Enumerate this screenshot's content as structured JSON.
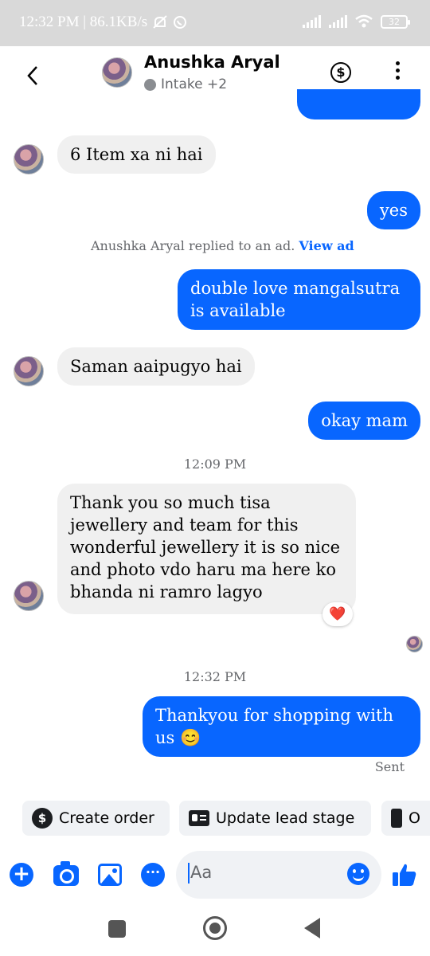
{
  "status_bar": {
    "time_speed": "12:32 PM | 86.1KB/s",
    "battery": "32"
  },
  "header": {
    "name": "Anushka Aryal",
    "subtitle": "Intake +2",
    "icons": [
      "back-arrow-icon",
      "dollar-icon",
      "more-vertical-icon"
    ]
  },
  "messages": [
    {
      "from": "contact",
      "text": "6 Item xa ni hai"
    },
    {
      "from": "me",
      "text": "yes"
    },
    {
      "type": "notice",
      "text": "Anushka Aryal replied to an ad.",
      "link": "View ad"
    },
    {
      "from": "me",
      "text": "double love mangalsutra is available"
    },
    {
      "from": "contact",
      "text": "Saman aaipugyo hai"
    },
    {
      "from": "me",
      "text": "okay mam"
    },
    {
      "type": "timestamp",
      "text": "12:09 PM"
    },
    {
      "from": "contact",
      "text": "Thank you so much tisa jewellery and team for this wonderful jewellery it is so nice and photo vdo haru ma here ko bhanda ni ramro lagyo",
      "reaction": "❤️"
    },
    {
      "type": "timestamp",
      "text": "12:32 PM"
    },
    {
      "from": "me",
      "text": "Thankyou for shopping with us 😊",
      "status": "Sent"
    }
  ],
  "quick_actions": [
    {
      "label": "Create order",
      "icon": "dollar-circle-icon"
    },
    {
      "label": "Update lead stage",
      "icon": "contact-card-icon"
    },
    {
      "label": "O",
      "icon": "list-icon"
    }
  ],
  "composer": {
    "placeholder": "Aa",
    "icons": [
      "plus-icon",
      "camera-icon",
      "gallery-icon",
      "more-icon",
      "emoji-icon",
      "thumbs-up-icon"
    ]
  },
  "colors": {
    "accent": "#0866ff",
    "incoming_bubble": "#f0f0f0",
    "status_bar": "#d9d9d9"
  }
}
